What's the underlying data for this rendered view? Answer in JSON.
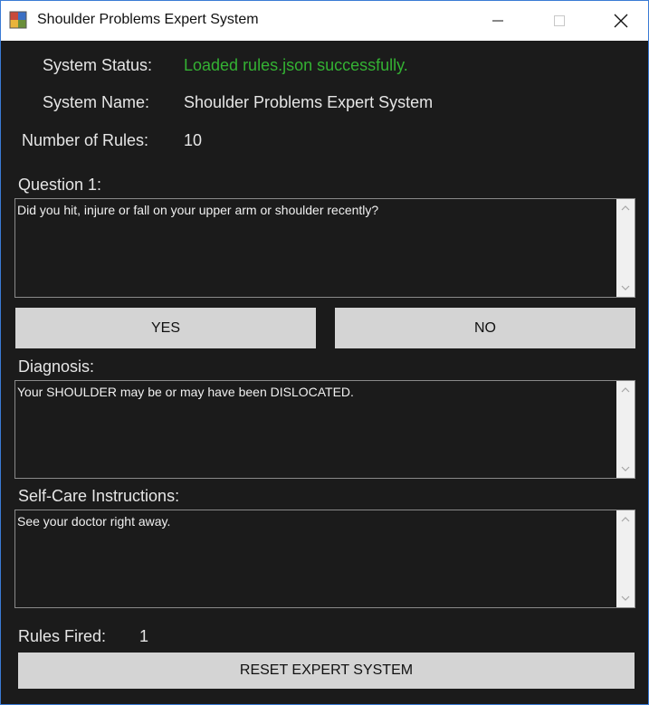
{
  "window": {
    "title": "Shoulder Problems Expert System"
  },
  "status": {
    "status_label": "System Status:",
    "status_value": "Loaded rules.json successfully.",
    "status_color": "#34b233",
    "name_label": "System Name:",
    "name_value": "Shoulder Problems Expert System",
    "rules_label": "Number of Rules:",
    "rules_value": "10"
  },
  "question": {
    "label": "Question 1:",
    "text": "Did you hit, injure or fall on your upper arm or shoulder recently?"
  },
  "answers": {
    "yes_label": "YES",
    "no_label": "NO"
  },
  "diagnosis": {
    "label": "Diagnosis:",
    "text": "Your SHOULDER may be or may have been DISLOCATED."
  },
  "self_care": {
    "label": "Self-Care Instructions:",
    "text": "See your doctor right away."
  },
  "rules_fired": {
    "label": "Rules Fired:",
    "value": "1"
  },
  "reset": {
    "label": "RESET EXPERT SYSTEM"
  },
  "icons": {
    "app": "app-icon",
    "minimize": "minimize-icon",
    "maximize": "maximize-icon",
    "close": "close-icon",
    "scroll_up": "chevron-up-icon",
    "scroll_down": "chevron-down-icon"
  }
}
